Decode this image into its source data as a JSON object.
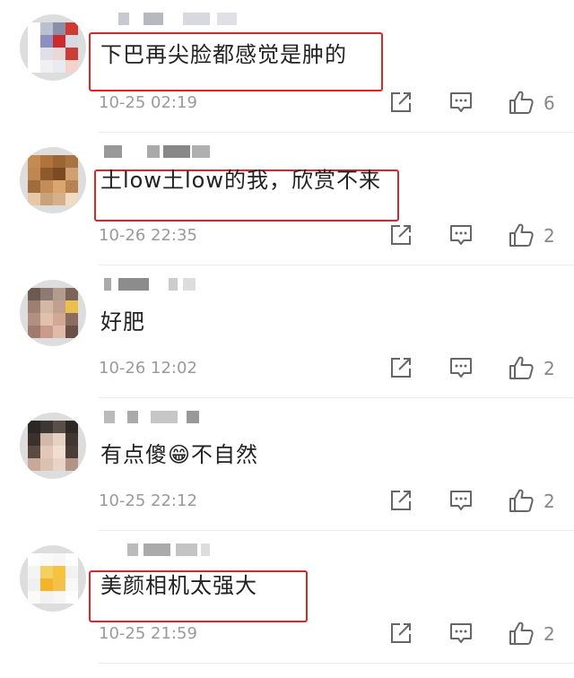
{
  "comments": [
    {
      "text": "下巴再尖脸都感觉是肿的",
      "time": "10-25 02:19",
      "likes": "6",
      "highlighted": true,
      "avatar_colors": [
        "#ffffff",
        "#b9c0cf",
        "#8a8fa8",
        "#cf3a33",
        "#ffffff",
        "#8d8ec2",
        "#cc2a2e",
        "#d8d8e2",
        "#ffffff",
        "#e0e0e8",
        "#e8d8d8",
        "#cc3d3a",
        "#ffffff",
        "#f0f0f4",
        "#e9e9f0",
        "#f6d2c9"
      ]
    },
    {
      "text": "土low土low的我，欣赏不来",
      "time": "10-26 22:35",
      "likes": "2",
      "highlighted": true,
      "avatar_colors": [
        "#c48b52",
        "#b0733b",
        "#9c6534",
        "#a87241",
        "#c08752",
        "#8e5a2c",
        "#7a4a22",
        "#d0a070",
        "#a06c3c",
        "#c28d5a",
        "#d9a66f",
        "#b88250",
        "#e6c8a8",
        "#caa27a",
        "#d6b088",
        "#f0dcc4"
      ]
    },
    {
      "text": "好肥",
      "time": "10-26 12:02",
      "likes": "2",
      "highlighted": false,
      "avatar_colors": [
        "#6b5a52",
        "#8e7a72",
        "#b59a8e",
        "#7b6458",
        "#9c7f72",
        "#d5b7a6",
        "#c2a090",
        "#e9c04c",
        "#b48e80",
        "#e2c0ae",
        "#d0a894",
        "#8c6c5e",
        "#a07a6c",
        "#c89c88",
        "#e0bca8",
        "#6a5046"
      ]
    },
    {
      "text": "有点傻😁不自然",
      "time": "10-25 22:12",
      "likes": "2",
      "highlighted": false,
      "avatar_colors": [
        "#2a2624",
        "#3c3634",
        "#5a4e48",
        "#2e2826",
        "#3a302c",
        "#d2b8a8",
        "#e6d2c4",
        "#403632",
        "#5c4a42",
        "#e2c8b8",
        "#f0dcd0",
        "#4a3c36",
        "#c8a898",
        "#dcc0b0",
        "#e8d4c6",
        "#b49484"
      ]
    },
    {
      "text": "美颜相机太强大",
      "time": "10-25 21:59",
      "likes": "2",
      "highlighted": true,
      "avatar_colors": [
        "#ffffff",
        "#fafafa",
        "#f6f6f6",
        "#ffffff",
        "#f4f4f4",
        "#f3d060",
        "#f7c23e",
        "#f2f2f2",
        "#f0f0f0",
        "#f5b32a",
        "#f4c24a",
        "#f8f8f8",
        "#fafafa",
        "#f2f2f2",
        "#f6f6f6",
        "#ffffff"
      ]
    }
  ]
}
